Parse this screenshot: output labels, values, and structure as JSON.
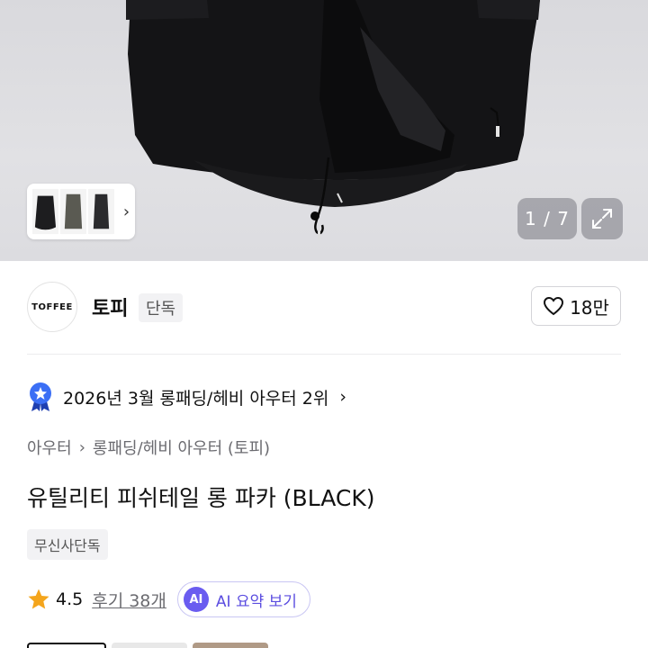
{
  "gallery": {
    "counter": "1 / 7",
    "thumb_colors": [
      "#1d1d1f",
      "#5a5a52",
      "#2b2b2d"
    ]
  },
  "brand": {
    "logo_text": "TOFFEE",
    "name": "토피",
    "badge": "단독",
    "likes": "18만"
  },
  "ranking": {
    "text": "2026년 3월 롱패딩/헤비 아우터 2위"
  },
  "breadcrumb": {
    "level1": "아우터",
    "level2": "롱패딩/헤비 아우터 (토피)"
  },
  "product": {
    "title": "유틸리티 피쉬테일 롱 파카 (BLACK)",
    "tag": "무신사단독"
  },
  "rating": {
    "score": "4.5",
    "reviews": "후기 38개",
    "ai_chip": "AI",
    "ai_label": "AI 요약 보기"
  },
  "colors": {
    "star": "#f4a51c",
    "rank_badge": "#3b6ff5",
    "ai_accent": "#6a5cf0"
  }
}
